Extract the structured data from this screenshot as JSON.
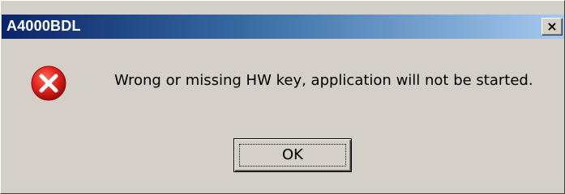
{
  "window": {
    "title": "A4000BDL",
    "close_label": "×",
    "close_icon": "close-icon"
  },
  "dialog": {
    "icon": "error-icon",
    "message": "Wrong or missing HW key, application will not be started.",
    "ok_label": "OK"
  },
  "colors": {
    "titlebar_start": "#0a246a",
    "titlebar_end": "#a6caf0",
    "dialog_background": "#d4d0c8",
    "error_red": "#e0201a"
  }
}
